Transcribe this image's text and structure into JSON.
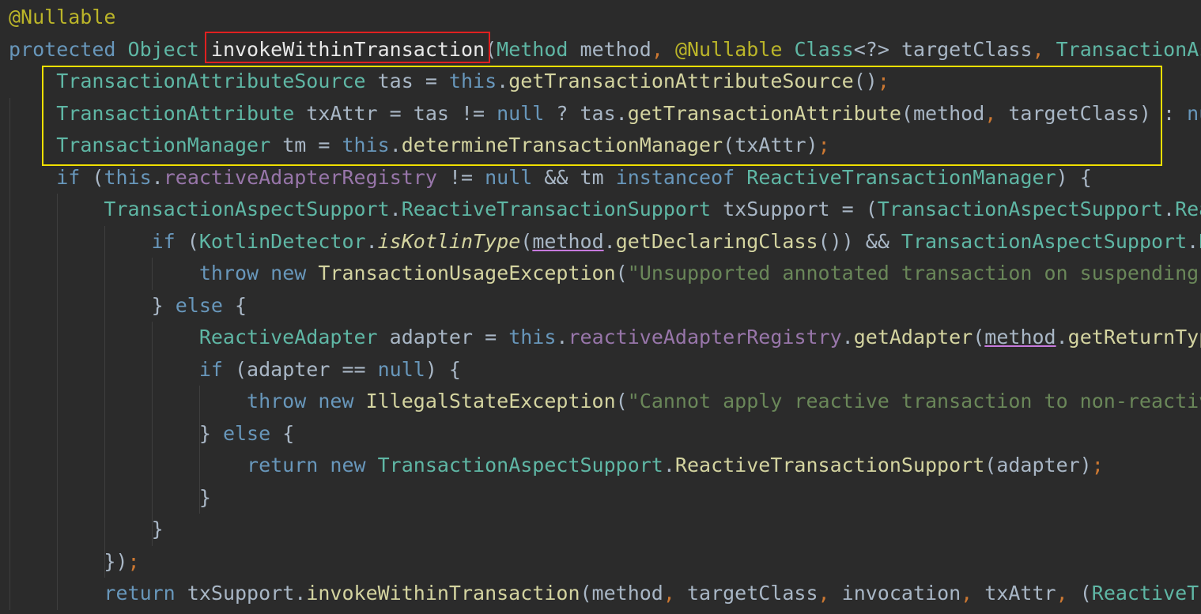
{
  "code_lines": [
    {
      "tokens": [
        {
          "t": "@Nullable",
          "c": "ann"
        }
      ]
    },
    {
      "tokens": [
        {
          "t": "protected",
          "c": "kwb"
        },
        {
          "t": " ",
          "c": "plain"
        },
        {
          "t": "Object",
          "c": "type"
        },
        {
          "t": " ",
          "c": "plain"
        },
        {
          "t": "invokeWithinTransaction",
          "c": "sig-method"
        },
        {
          "t": "(",
          "c": "plain"
        },
        {
          "t": "Method",
          "c": "type"
        },
        {
          "t": " method",
          "c": "plain"
        },
        {
          "t": ", ",
          "c": "punct"
        },
        {
          "t": "@Nullable",
          "c": "ann"
        },
        {
          "t": " ",
          "c": "plain"
        },
        {
          "t": "Class",
          "c": "type"
        },
        {
          "t": "<?> targetClass",
          "c": "plain"
        },
        {
          "t": ", ",
          "c": "punct"
        },
        {
          "t": "TransactionAs",
          "c": "type"
        }
      ]
    },
    {
      "tokens": [
        {
          "t": "    ",
          "c": "plain"
        },
        {
          "t": "TransactionAttributeSource",
          "c": "type"
        },
        {
          "t": " tas = ",
          "c": "plain"
        },
        {
          "t": "this",
          "c": "kwb"
        },
        {
          "t": ".",
          "c": "plain"
        },
        {
          "t": "getTransactionAttributeSource",
          "c": "call"
        },
        {
          "t": "()",
          "c": "plain"
        },
        {
          "t": ";",
          "c": "punct"
        }
      ]
    },
    {
      "tokens": [
        {
          "t": "    ",
          "c": "plain"
        },
        {
          "t": "TransactionAttribute",
          "c": "type"
        },
        {
          "t": " txAttr = tas != ",
          "c": "plain"
        },
        {
          "t": "null",
          "c": "kwb"
        },
        {
          "t": " ? tas.",
          "c": "plain"
        },
        {
          "t": "getTransactionAttribute",
          "c": "call"
        },
        {
          "t": "(method",
          "c": "plain"
        },
        {
          "t": ", ",
          "c": "punct"
        },
        {
          "t": "targetClass) : ",
          "c": "plain"
        },
        {
          "t": "nu",
          "c": "kwb"
        }
      ]
    },
    {
      "tokens": [
        {
          "t": "    ",
          "c": "plain"
        },
        {
          "t": "TransactionManager",
          "c": "type"
        },
        {
          "t": " tm = ",
          "c": "plain"
        },
        {
          "t": "this",
          "c": "kwb"
        },
        {
          "t": ".",
          "c": "plain"
        },
        {
          "t": "determineTransactionManager",
          "c": "call"
        },
        {
          "t": "(txAttr)",
          "c": "plain"
        },
        {
          "t": ";",
          "c": "punct"
        }
      ]
    },
    {
      "tokens": [
        {
          "t": "    ",
          "c": "plain"
        },
        {
          "t": "if",
          "c": "kwb"
        },
        {
          "t": " (",
          "c": "plain"
        },
        {
          "t": "this",
          "c": "kwb"
        },
        {
          "t": ".",
          "c": "plain"
        },
        {
          "t": "reactiveAdapterRegistry",
          "c": "field"
        },
        {
          "t": " != ",
          "c": "plain"
        },
        {
          "t": "null",
          "c": "kwb"
        },
        {
          "t": " && tm ",
          "c": "plain"
        },
        {
          "t": "instanceof",
          "c": "kwb"
        },
        {
          "t": " ",
          "c": "plain"
        },
        {
          "t": "ReactiveTransactionManager",
          "c": "type"
        },
        {
          "t": ") {",
          "c": "plain"
        }
      ]
    },
    {
      "tokens": [
        {
          "t": "        ",
          "c": "plain"
        },
        {
          "t": "TransactionAspectSupport",
          "c": "type"
        },
        {
          "t": ".",
          "c": "plain"
        },
        {
          "t": "ReactiveTransactionSupport",
          "c": "type"
        },
        {
          "t": " txSupport = (",
          "c": "plain"
        },
        {
          "t": "TransactionAspectSupport",
          "c": "type"
        },
        {
          "t": ".",
          "c": "plain"
        },
        {
          "t": "Rea",
          "c": "type"
        }
      ]
    },
    {
      "tokens": [
        {
          "t": "            ",
          "c": "plain"
        },
        {
          "t": "if",
          "c": "kwb"
        },
        {
          "t": " (",
          "c": "plain"
        },
        {
          "t": "KotlinDetector",
          "c": "type"
        },
        {
          "t": ".",
          "c": "plain"
        },
        {
          "t": "isKotlinType",
          "c": "static"
        },
        {
          "t": "(",
          "c": "plain"
        },
        {
          "t": "method",
          "c": "ul"
        },
        {
          "t": ".",
          "c": "plain"
        },
        {
          "t": "getDeclaringClass",
          "c": "call"
        },
        {
          "t": "()) && ",
          "c": "plain"
        },
        {
          "t": "TransactionAspectSupport",
          "c": "type"
        },
        {
          "t": ".",
          "c": "plain"
        },
        {
          "t": "K",
          "c": "type"
        }
      ]
    },
    {
      "tokens": [
        {
          "t": "                ",
          "c": "plain"
        },
        {
          "t": "throw",
          "c": "kwb"
        },
        {
          "t": " ",
          "c": "plain"
        },
        {
          "t": "new",
          "c": "kwb"
        },
        {
          "t": " ",
          "c": "plain"
        },
        {
          "t": "TransactionUsageException",
          "c": "call"
        },
        {
          "t": "(",
          "c": "plain"
        },
        {
          "t": "\"Unsupported annotated transaction on suspending",
          "c": "str"
        }
      ]
    },
    {
      "tokens": [
        {
          "t": "            } ",
          "c": "plain"
        },
        {
          "t": "else",
          "c": "kwb"
        },
        {
          "t": " {",
          "c": "plain"
        }
      ]
    },
    {
      "tokens": [
        {
          "t": "                ",
          "c": "plain"
        },
        {
          "t": "ReactiveAdapter",
          "c": "type"
        },
        {
          "t": " adapter = ",
          "c": "plain"
        },
        {
          "t": "this",
          "c": "kwb"
        },
        {
          "t": ".",
          "c": "plain"
        },
        {
          "t": "reactiveAdapterRegistry",
          "c": "field"
        },
        {
          "t": ".",
          "c": "plain"
        },
        {
          "t": "getAdapter",
          "c": "call"
        },
        {
          "t": "(",
          "c": "plain"
        },
        {
          "t": "method",
          "c": "ul"
        },
        {
          "t": ".",
          "c": "plain"
        },
        {
          "t": "getReturnTyp",
          "c": "call"
        }
      ]
    },
    {
      "tokens": [
        {
          "t": "                ",
          "c": "plain"
        },
        {
          "t": "if",
          "c": "kwb"
        },
        {
          "t": " (adapter == ",
          "c": "plain"
        },
        {
          "t": "null",
          "c": "kwb"
        },
        {
          "t": ") {",
          "c": "plain"
        }
      ]
    },
    {
      "tokens": [
        {
          "t": "                    ",
          "c": "plain"
        },
        {
          "t": "throw",
          "c": "kwb"
        },
        {
          "t": " ",
          "c": "plain"
        },
        {
          "t": "new",
          "c": "kwb"
        },
        {
          "t": " ",
          "c": "plain"
        },
        {
          "t": "IllegalStateException",
          "c": "call"
        },
        {
          "t": "(",
          "c": "plain"
        },
        {
          "t": "\"Cannot apply reactive transaction to non-reactiv",
          "c": "str"
        }
      ]
    },
    {
      "tokens": [
        {
          "t": "                } ",
          "c": "plain"
        },
        {
          "t": "else",
          "c": "kwb"
        },
        {
          "t": " {",
          "c": "plain"
        }
      ]
    },
    {
      "tokens": [
        {
          "t": "                    ",
          "c": "plain"
        },
        {
          "t": "return",
          "c": "kwb"
        },
        {
          "t": " ",
          "c": "plain"
        },
        {
          "t": "new",
          "c": "kwb"
        },
        {
          "t": " ",
          "c": "plain"
        },
        {
          "t": "TransactionAspectSupport",
          "c": "type"
        },
        {
          "t": ".",
          "c": "plain"
        },
        {
          "t": "ReactiveTransactionSupport",
          "c": "call"
        },
        {
          "t": "(adapter)",
          "c": "plain"
        },
        {
          "t": ";",
          "c": "punct"
        }
      ]
    },
    {
      "tokens": [
        {
          "t": "                }",
          "c": "plain"
        }
      ]
    },
    {
      "tokens": [
        {
          "t": "            }",
          "c": "plain"
        }
      ]
    },
    {
      "tokens": [
        {
          "t": "        })",
          "c": "plain"
        },
        {
          "t": ";",
          "c": "punct"
        }
      ]
    },
    {
      "tokens": [
        {
          "t": "        ",
          "c": "plain"
        },
        {
          "t": "return",
          "c": "kwb"
        },
        {
          "t": " txSupport.",
          "c": "plain"
        },
        {
          "t": "invokeWithinTransaction",
          "c": "call"
        },
        {
          "t": "(method",
          "c": "plain"
        },
        {
          "t": ", ",
          "c": "punct"
        },
        {
          "t": "targetClass",
          "c": "plain"
        },
        {
          "t": ", ",
          "c": "punct"
        },
        {
          "t": "invocation",
          "c": "plain"
        },
        {
          "t": ", ",
          "c": "punct"
        },
        {
          "t": "txAttr",
          "c": "plain"
        },
        {
          "t": ", ",
          "c": "punct"
        },
        {
          "t": "(",
          "c": "plain"
        },
        {
          "t": "ReactiveTr",
          "c": "type"
        }
      ]
    }
  ],
  "highlights": {
    "red_box_label": "method-name-highlight",
    "yellow_box_label": "setup-lines-highlight"
  },
  "colors": {
    "background": "#2b2b2b",
    "red_box": "#e02020",
    "yellow_box": "#f0e000"
  }
}
